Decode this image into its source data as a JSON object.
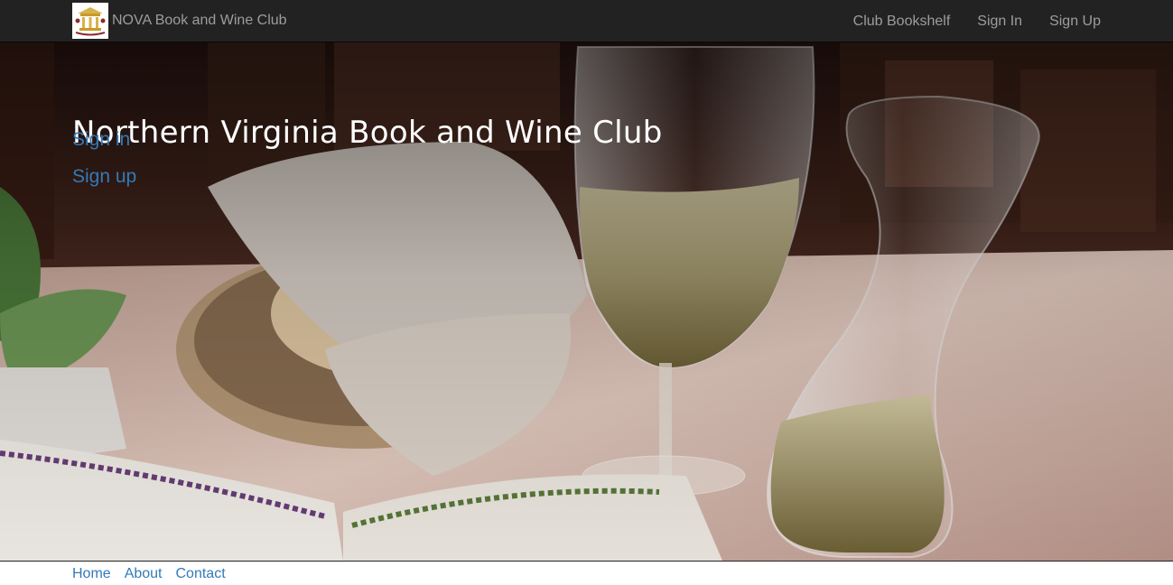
{
  "navbar": {
    "brand_text": "NOVA Book and Wine Club",
    "logo_icon": "club-crest-logo",
    "links": [
      {
        "label": "Club Bookshelf"
      },
      {
        "label": "Sign In"
      },
      {
        "label": "Sign Up"
      }
    ]
  },
  "hero": {
    "title": "Northern Virginia Book and Wine Club",
    "links": [
      {
        "label": "Sign in"
      },
      {
        "label": "Sign up"
      }
    ],
    "background_image": "bread-basket-wine-glass-carafe-open-book-photo"
  },
  "footer": {
    "links": [
      {
        "label": "Home"
      },
      {
        "label": "About"
      },
      {
        "label": "Contact"
      }
    ]
  },
  "colors": {
    "navbar_bg": "#222222",
    "nav_text": "#9d9d9d",
    "link": "#337ab7",
    "hero_title": "#ffffff"
  }
}
